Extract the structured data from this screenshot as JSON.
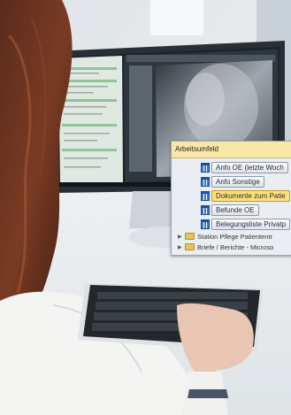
{
  "panel": {
    "title": "Arbeitsumfeld",
    "items": [
      {
        "label": "Anfo OE (letzte Woch"
      },
      {
        "label": "Anfo Sonstige"
      },
      {
        "label": "Dokumente zum Patie"
      },
      {
        "label": "Befunde OE"
      },
      {
        "label": "Belegungsliste Privatp"
      }
    ],
    "folders": [
      {
        "label": "Station Pflege Patiententr"
      },
      {
        "label": "Briefe / Berichte - Microso"
      }
    ]
  }
}
